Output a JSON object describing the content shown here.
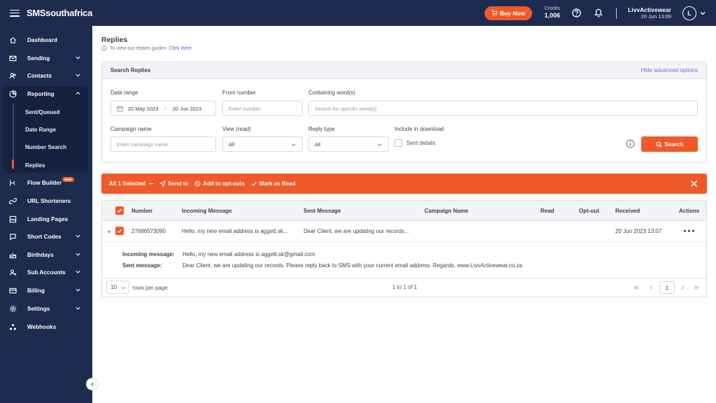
{
  "app": {
    "logo": "SMSsouthafrica"
  },
  "topbar": {
    "buy_label": "Buy Now",
    "credits_label": "Credits",
    "credits_value": "1,006",
    "account_name": "LivvActivewear",
    "account_date": "20 Jun 13:09",
    "avatar_letter": "L"
  },
  "sidebar": {
    "items": [
      {
        "label": "Dashboard",
        "icon": "home-icon"
      },
      {
        "label": "Sending",
        "icon": "envelope-icon"
      },
      {
        "label": "Contacts",
        "icon": "contacts-icon"
      },
      {
        "label": "Reporting",
        "icon": "reporting-icon"
      },
      {
        "label": "Flow Builder",
        "icon": "flow-icon",
        "badge": "NEW"
      },
      {
        "label": "URL Shorteners",
        "icon": "link-icon"
      },
      {
        "label": "Landing Pages",
        "icon": "landing-icon"
      },
      {
        "label": "Short Codes",
        "icon": "shortcode-icon"
      },
      {
        "label": "Birthdays",
        "icon": "birthday-icon"
      },
      {
        "label": "Sub Accounts",
        "icon": "subaccount-icon"
      },
      {
        "label": "Billing",
        "icon": "billing-icon"
      },
      {
        "label": "Settings",
        "icon": "gear-icon"
      },
      {
        "label": "Webhooks",
        "icon": "webhook-icon"
      }
    ],
    "reporting_sub": [
      "Sent/Queued",
      "Date Range",
      "Number Search",
      "Replies"
    ]
  },
  "page": {
    "title": "Replies",
    "hint_text": "To view our replies guides",
    "hint_link": "Click Here."
  },
  "search": {
    "title": "Search Replies",
    "hide_link": "Hide advanced options",
    "date_range_label": "Date range",
    "date_from": "20 May 2023",
    "date_sep": "-",
    "date_to": "20 Jun 2023",
    "from_number_label": "From number",
    "from_number_placeholder": "Enter number",
    "containing_label": "Containing word(s)",
    "containing_placeholder": "Search for specific word(s)",
    "campaign_label": "Campaign name",
    "campaign_placeholder": "Enter campaign name",
    "view_label": "View (read)",
    "view_value": "All",
    "reply_type_label": "Reply type",
    "reply_type_value": "All",
    "include_label": "Include in download",
    "sent_details_label": "Sent details",
    "search_button": "Search"
  },
  "action_bar": {
    "selected": "All 1 Selected",
    "send_to": "Send to",
    "opt_outs": "Add to opt-outs",
    "mark_read": "Mark as Read"
  },
  "table": {
    "columns": [
      "Number",
      "Incoming Message",
      "Sent Message",
      "Campaign Name",
      "Read",
      "Opt-out",
      "Received",
      "Actions"
    ],
    "row": {
      "number": "27686573090",
      "incoming": "Hello, my new email address is aggett.sk...",
      "sent": "Dear Client, we are updating our records...",
      "received": "20 Jun 2023 13:07"
    },
    "detail": {
      "incoming_label": "Incoming message:",
      "incoming_value": "Hello, my new email address is aggett.sk@gmail.com",
      "sent_label": "Sent message:",
      "sent_value": "Dear Client, we are updating our records. Please reply back to SMS with your current email address. Regards, www.LivvActivewear.co.za"
    },
    "footer": {
      "per_page": "10",
      "rows_label": "rows per page",
      "range": "1 to 1 of 1",
      "current_page": "1"
    }
  },
  "colors": {
    "navy": "#1d2b4f",
    "accent": "#f05a2a",
    "link": "#6b4fd8"
  }
}
